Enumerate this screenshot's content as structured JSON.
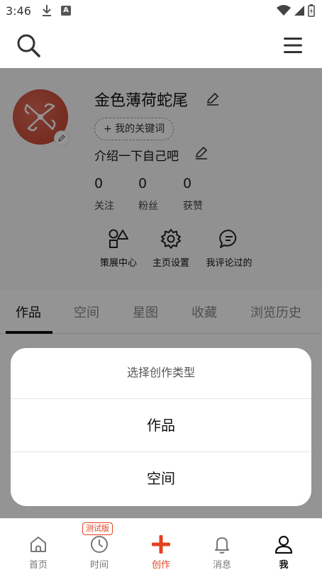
{
  "status_bar": {
    "time": "3:46",
    "a_icon": "A"
  },
  "profile": {
    "username": "金色薄荷蛇尾",
    "keyword_button": "+ 我的关键词",
    "bio": "介绍一下自己吧",
    "stats": [
      {
        "value": "0",
        "label": "关注"
      },
      {
        "value": "0",
        "label": "粉丝"
      },
      {
        "value": "0",
        "label": "获赞"
      }
    ],
    "actions": [
      {
        "label": "策展中心",
        "icon": "shapes-icon"
      },
      {
        "label": "主页设置",
        "icon": "gear-icon"
      },
      {
        "label": "我评论过的",
        "icon": "comment-icon"
      }
    ]
  },
  "tabs": [
    {
      "label": "作品",
      "active": true
    },
    {
      "label": "空间"
    },
    {
      "label": "星图"
    },
    {
      "label": "收藏"
    },
    {
      "label": "浏览历史"
    }
  ],
  "sheet": {
    "title": "选择创作类型",
    "options": [
      "作品",
      "空间"
    ]
  },
  "bottom_nav": {
    "items": [
      {
        "label": "首页",
        "icon": "home-icon"
      },
      {
        "label": "时间",
        "icon": "clock-icon"
      },
      {
        "label": "创作",
        "icon": "plus-icon"
      },
      {
        "label": "消息",
        "icon": "bell-icon"
      },
      {
        "label": "我",
        "icon": "person-icon"
      }
    ],
    "beta_badge": "测试版"
  },
  "colors": {
    "accent": "#e4401f",
    "overlay": "rgba(0,0,0,0.42)"
  }
}
